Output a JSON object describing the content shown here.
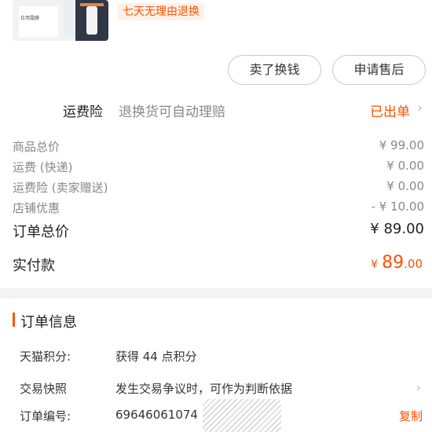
{
  "product": {
    "image_label": "日用霜膜",
    "tag": "七天无理由退换"
  },
  "actions": {
    "sell_label": "卖了换钱",
    "after_sale_label": "申请售后"
  },
  "insurance": {
    "title": "运费险",
    "desc": "退换货可自动理赔",
    "status": "已出单",
    "arrow": "›"
  },
  "prices": [
    {
      "label": "商品总价",
      "value": "¥ 99.00"
    },
    {
      "label": "运费 (快递)",
      "value": "¥ 0.00"
    },
    {
      "label": "运费险 (卖家赠送)",
      "value": "¥ 0.00"
    },
    {
      "label": "店铺优惠",
      "value": "- ¥ 10.00"
    }
  ],
  "total": {
    "label": "订单总价",
    "value": "¥ 89.00"
  },
  "paid": {
    "label": "实付款",
    "currency": "¥",
    "int": "89",
    "dec": ".00"
  },
  "order_info": {
    "title": "订单信息",
    "rows": [
      {
        "label": "天猫积分:",
        "value": "获得 44 点积分"
      },
      {
        "label": "交易快照",
        "value": "发生交易争议时，可作为判断依据",
        "arrow": "›"
      },
      {
        "label": "订单编号:",
        "value": "69646061074",
        "action": "复制"
      }
    ]
  }
}
